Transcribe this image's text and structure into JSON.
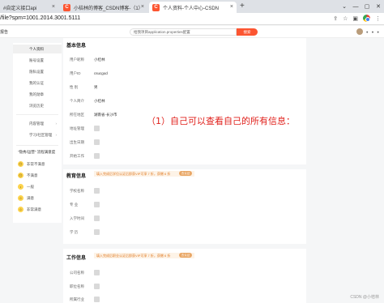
{
  "browser": {
    "tabs": [
      {
        "title": "#自定义接口api",
        "favicon": "",
        "active": false
      },
      {
        "title": "小桔林的博客_CSDN博客-（1）",
        "favicon": "C",
        "active": false
      },
      {
        "title": "个人资料-个人中心-CSDN",
        "favicon": "C",
        "active": true
      }
    ],
    "new_tab_symbol": "+",
    "window_controls": [
      "⌄",
      "—",
      "▢",
      "✕"
    ],
    "url": "/file?spm=1001.2014.3001.5111",
    "tab_close_symbol": "×"
  },
  "site_nav": {
    "left_text": "报告",
    "search_placeholder": "给我项目application.properties配置",
    "search_button": "搜索",
    "accent": "#fc5531"
  },
  "sidebar": {
    "items": [
      {
        "label": "个人资料",
        "active": true,
        "arrow": ""
      },
      {
        "label": "账号设置",
        "active": false,
        "arrow": ""
      },
      {
        "label": "隐私设置",
        "active": false,
        "arrow": ""
      },
      {
        "label": "我的认证",
        "active": false,
        "arrow": ""
      },
      {
        "label": "我的勋章",
        "active": false,
        "arrow": ""
      },
      {
        "label": "浏览历史",
        "active": false,
        "arrow": ""
      },
      {
        "label": "内容管理",
        "active": false,
        "arrow": "›"
      },
      {
        "label": "学习/社区管理",
        "active": false,
        "arrow": "›"
      }
    ],
    "feedback_title": "\"隐秀/运营\" 流程满意度",
    "feedback_options": [
      "非常不满意",
      "不满意",
      "一般",
      "满意",
      "非常满意"
    ]
  },
  "basic_info": {
    "title": "基本信息",
    "rows": [
      {
        "label": "用户昵称",
        "value": "小桔林"
      },
      {
        "label": "用户ID",
        "value": "csucgod"
      },
      {
        "label": "性    别",
        "value": "男"
      },
      {
        "label": "个人简介",
        "value": "小桔林"
      },
      {
        "label": "所在地区",
        "value": "湖南省-长沙市"
      },
      {
        "label": "地址管理",
        "value": ""
      },
      {
        "label": "出生日期",
        "value": ""
      },
      {
        "label": "开始工作",
        "value": ""
      }
    ]
  },
  "annotation": "（1）自己可以查看自己的所有信息：",
  "education": {
    "title": "教育信息",
    "notice": "填入完成后学位认证后即获VIP可享 7 折，获赠 6 折",
    "tag": "去认证",
    "rows": [
      {
        "label": "学校名称"
      },
      {
        "label": "专    业"
      },
      {
        "label": "入学时间"
      },
      {
        "label": "学    历"
      }
    ]
  },
  "work": {
    "title": "工作信息",
    "notice": "填入完成后职业认证后即获VIP可享 7 折，获赠 6 折",
    "tag": "去认证",
    "rows": [
      {
        "label": "公司名称"
      },
      {
        "label": "职位名称"
      },
      {
        "label": "所属行业"
      }
    ]
  },
  "footer": "CSDN @小桔林"
}
